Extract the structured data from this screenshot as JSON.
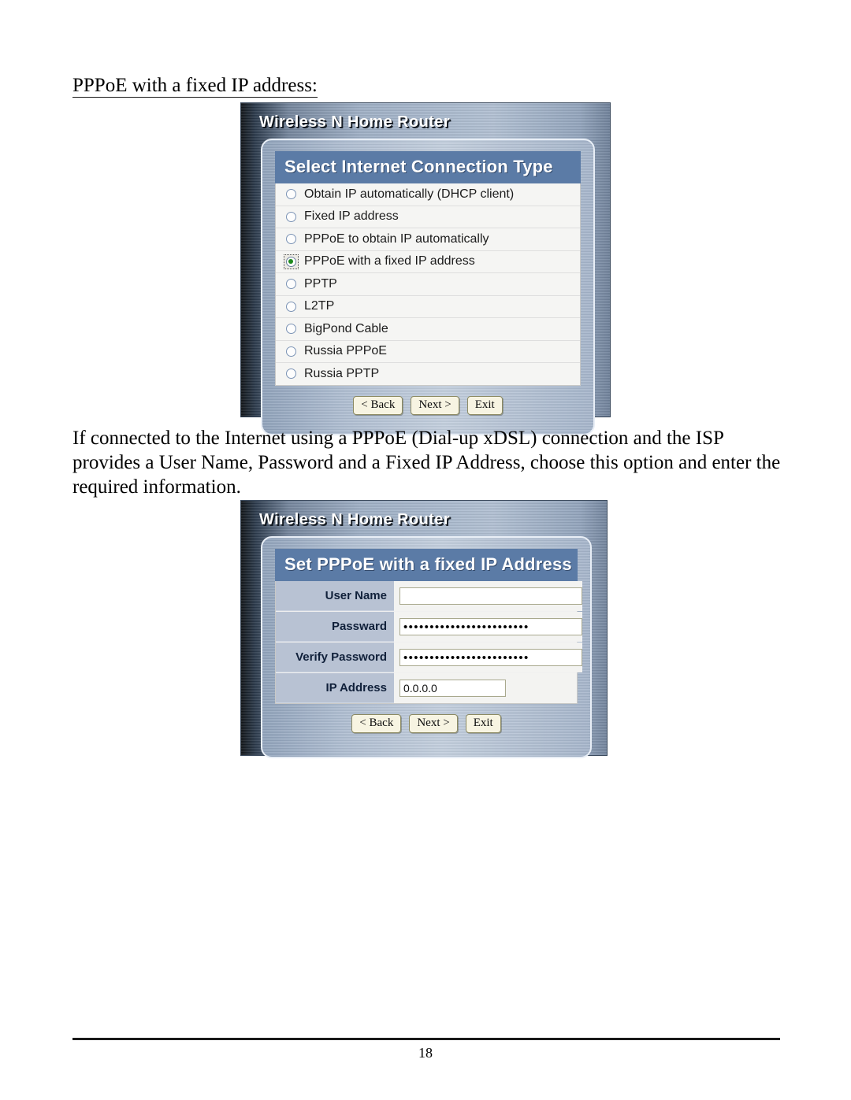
{
  "document": {
    "heading": "PPPoE with a fixed IP address:",
    "paragraph": "If connected to the Internet using a PPPoE (Dial-up xDSL) connection and the ISP provides a User Name, Password and a Fixed IP Address, choose this option and enter the required information.",
    "page_number": "18"
  },
  "colors": {
    "section_header_blue": "#5b7ba6",
    "label_cell_blue": "#b8c2d3",
    "selected_radio_green": "#1f8a1f",
    "button_cream": "#f7f4e2",
    "panel_border_white": "#e8eef6"
  },
  "figure1": {
    "window_title": "Wireless N Home Router",
    "section_title": "Select Internet Connection Type",
    "options": [
      {
        "label": "Obtain IP automatically (DHCP client)",
        "selected": false
      },
      {
        "label": "Fixed IP address",
        "selected": false
      },
      {
        "label": "PPPoE to obtain IP automatically",
        "selected": false
      },
      {
        "label": "PPPoE with a fixed IP address",
        "selected": true
      },
      {
        "label": "PPTP",
        "selected": false
      },
      {
        "label": "L2TP",
        "selected": false
      },
      {
        "label": "BigPond Cable",
        "selected": false
      },
      {
        "label": "Russia PPPoE",
        "selected": false
      },
      {
        "label": "Russia PPTP",
        "selected": false
      }
    ],
    "buttons": {
      "back": "< Back",
      "next": "Next >",
      "exit": "Exit"
    }
  },
  "figure2": {
    "window_title": "Wireless N Home Router",
    "section_title": "Set PPPoE with a fixed IP Address",
    "fields": [
      {
        "label": "User Name",
        "value": "",
        "kind": "text",
        "width": "wide"
      },
      {
        "label": "Passward",
        "value": "••••••••••••••••••••••••",
        "kind": "password",
        "width": "wide"
      },
      {
        "label": "Verify Password",
        "value": "••••••••••••••••••••••••",
        "kind": "password",
        "width": "wide"
      },
      {
        "label": "IP Address",
        "value": "0.0.0.0",
        "kind": "text",
        "width": "narrow"
      }
    ],
    "buttons": {
      "back": "< Back",
      "next": "Next >",
      "exit": "Exit"
    }
  }
}
